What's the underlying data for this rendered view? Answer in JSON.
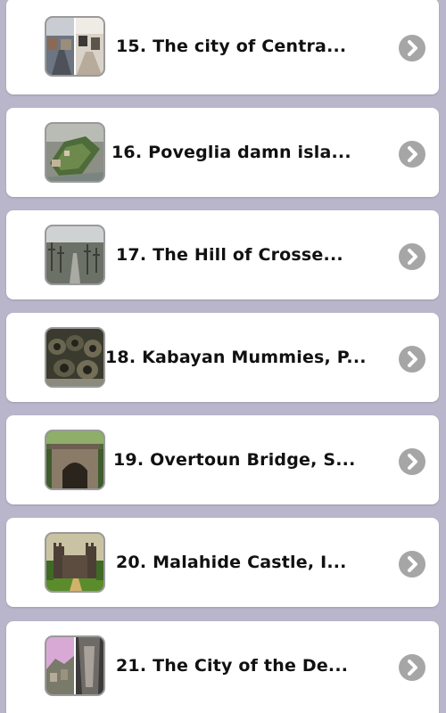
{
  "items": [
    {
      "title": "15. The city of Centra...",
      "thumb": "centralia-town-icon"
    },
    {
      "title": "16. Poveglia damn isla...",
      "thumb": "poveglia-island-icon"
    },
    {
      "title": "17. The Hill of Crosse...",
      "thumb": "hill-of-crosses-icon"
    },
    {
      "title": "18. Kabayan Mummies, P...",
      "thumb": "kabayan-mummies-icon"
    },
    {
      "title": "19. Overtoun Bridge, S...",
      "thumb": "overtoun-bridge-icon"
    },
    {
      "title": "20. Malahide Castle, I...",
      "thumb": "malahide-castle-icon"
    },
    {
      "title": "21. The City of the De...",
      "thumb": "city-of-the-dead-icon"
    }
  ],
  "chevron_icon": "chevron-right-icon",
  "colors": {
    "background": "#b9b6cb",
    "card": "#ffffff",
    "chevron": "#a6a6a6"
  }
}
